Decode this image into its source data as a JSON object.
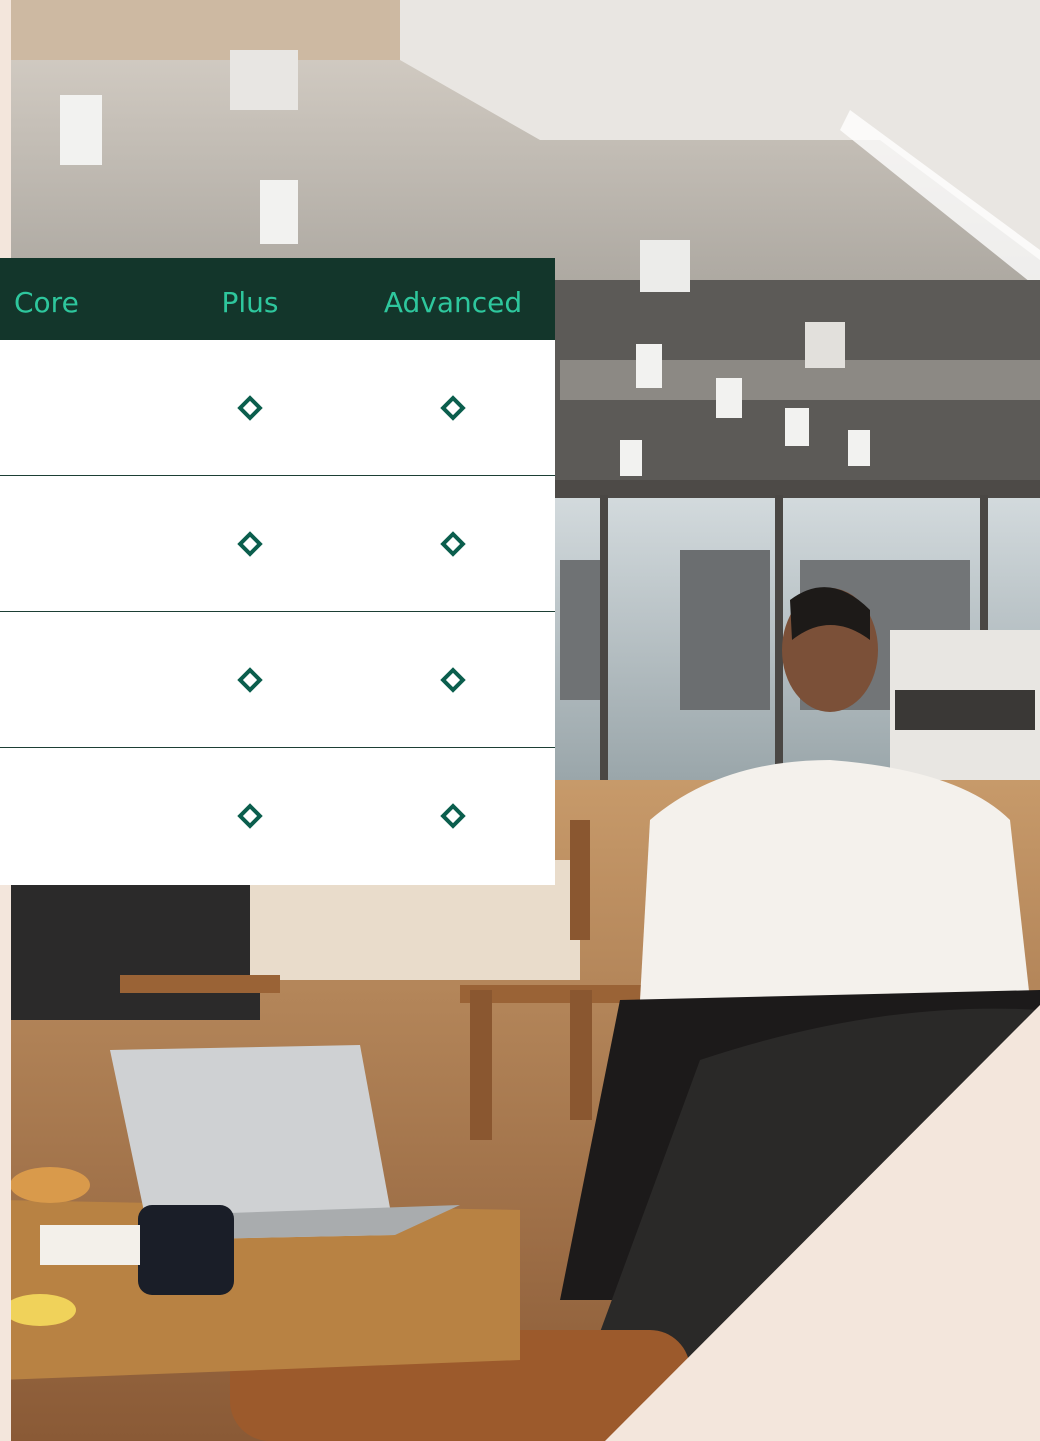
{
  "table": {
    "columns": [
      "Core",
      "Plus",
      "Advanced"
    ],
    "rows": [
      {
        "plus": "check-diamond-icon",
        "advanced": "check-diamond-icon"
      },
      {
        "plus": "check-diamond-icon",
        "advanced": "check-diamond-icon"
      },
      {
        "plus": "check-diamond-icon",
        "advanced": "check-diamond-icon"
      },
      {
        "plus": "check-diamond-icon",
        "advanced": "check-diamond-icon"
      }
    ]
  },
  "colors": {
    "header_bg": "#13362b",
    "header_text": "#2ec79d",
    "icon": "#0b5e4d",
    "background": "#f3e6dc"
  }
}
